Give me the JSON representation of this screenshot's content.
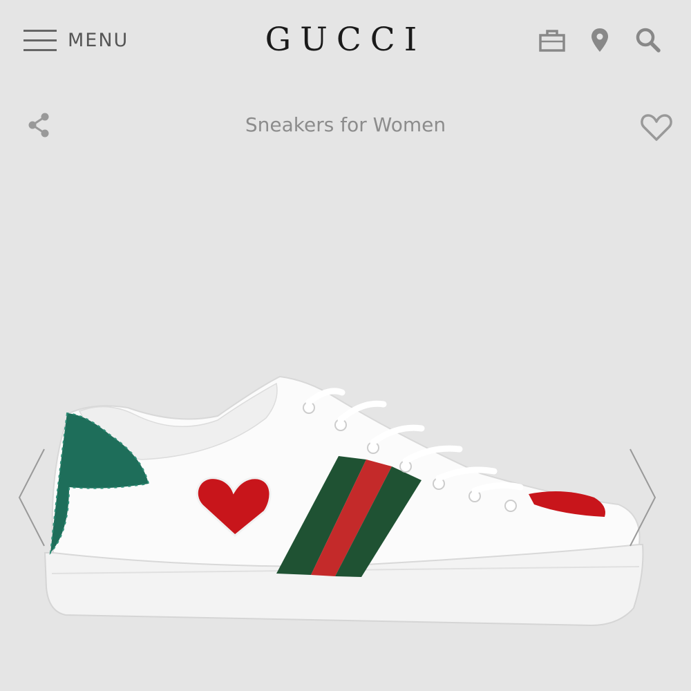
{
  "header": {
    "menu_label": "MENU",
    "brand": "GUCCI",
    "icons": [
      "menu-icon",
      "shopping-bag-icon",
      "location-pin-icon",
      "search-icon"
    ]
  },
  "product": {
    "title": "Sneakers for Women",
    "icons": [
      "share-icon",
      "heart-outline-icon",
      "chevron-left-icon",
      "chevron-right-icon"
    ]
  },
  "colors": {
    "background": "#e5e5e5",
    "icon_gray": "#8a8a8a",
    "web_stripe_green": "#1f5233",
    "web_stripe_red": "#c42a2a",
    "heart_red": "#c8151b",
    "heel_green": "#1e6e5a"
  }
}
